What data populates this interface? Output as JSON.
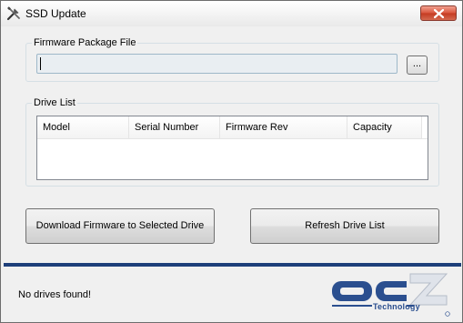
{
  "window": {
    "title": "SSD Update",
    "icon": "tools-icon",
    "close_icon": "close-icon"
  },
  "firmware": {
    "group_label": "Firmware Package File",
    "path_value": "",
    "browse_label": "..."
  },
  "drive_list": {
    "group_label": "Drive List",
    "columns": [
      "Model",
      "Serial Number",
      "Firmware Rev",
      "Capacity"
    ],
    "rows": []
  },
  "buttons": {
    "download_label": "Download Firmware to Selected Drive",
    "refresh_label": "Refresh Drive List"
  },
  "status": {
    "message": "No drives found!"
  },
  "logo": {
    "main": "OCZ",
    "sub": "Technology"
  },
  "colors": {
    "accent": "#1e3f7a",
    "logo_blue": "#2b4f8f",
    "close_red": "#c43b22"
  }
}
